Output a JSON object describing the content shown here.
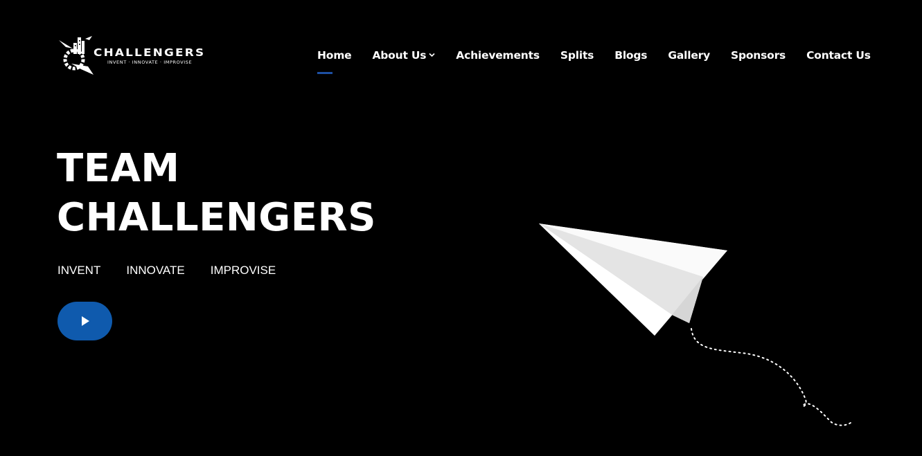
{
  "logo": {
    "wordmark": "CHALLENGERS",
    "tagline": "INVENT · INNOVATE · IMPROVISE"
  },
  "nav": {
    "items": [
      {
        "label": "Home",
        "active": true
      },
      {
        "label": "About Us",
        "has_dropdown": true
      },
      {
        "label": "Achievements"
      },
      {
        "label": "Splits"
      },
      {
        "label": "Blogs"
      },
      {
        "label": "Gallery"
      },
      {
        "label": "Sponsors"
      },
      {
        "label": "Contact Us"
      }
    ]
  },
  "hero": {
    "title_line1": "TEAM",
    "title_line2": "CHALLENGERS",
    "taglines": [
      "INVENT",
      "INNOVATE",
      "IMPROVISE"
    ]
  },
  "icons": {
    "play": "play-icon",
    "dropdown": "chevron-down-icon",
    "illustration": "paper-plane-illustration"
  },
  "colors": {
    "background": "#000000",
    "accent": "#0f5aad",
    "active_underline": "#1d4fa3",
    "text": "#ffffff"
  }
}
